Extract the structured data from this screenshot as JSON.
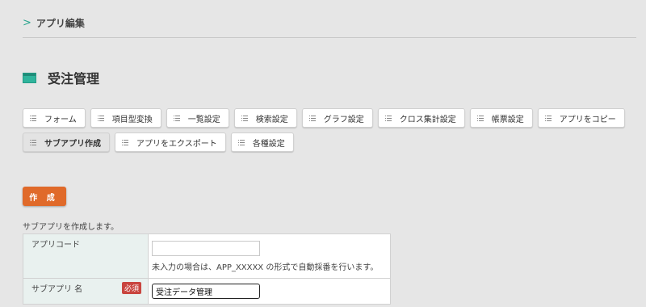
{
  "breadcrumb": {
    "label": "アプリ編集"
  },
  "app": {
    "title": "受注管理"
  },
  "tabs": [
    {
      "label": "フォーム",
      "active": false
    },
    {
      "label": "項目型変換",
      "active": false
    },
    {
      "label": "一覧設定",
      "active": false
    },
    {
      "label": "検索設定",
      "active": false
    },
    {
      "label": "グラフ設定",
      "active": false
    },
    {
      "label": "クロス集計設定",
      "active": false
    },
    {
      "label": "帳票設定",
      "active": false
    },
    {
      "label": "アプリをコピー",
      "active": false
    },
    {
      "label": "サブアプリ作成",
      "active": true
    },
    {
      "label": "アプリをエクスポート",
      "active": false
    },
    {
      "label": "各種設定",
      "active": false
    }
  ],
  "create_button": {
    "label": "作 成"
  },
  "form": {
    "description": "サブアプリを作成します。",
    "app_code": {
      "label": "アプリコード",
      "value": "",
      "hint": "未入力の場合は、APP_XXXXX の形式で自動採番を行います。"
    },
    "sub_app_name": {
      "label": "サブアプリ 名",
      "required_badge": "必須",
      "value": "受注データ管理"
    }
  },
  "colors": {
    "accent": "#2fb49c",
    "create_button": "#e06a2a",
    "required_badge": "#c9453f",
    "label_cell": "#e9f1ef"
  }
}
